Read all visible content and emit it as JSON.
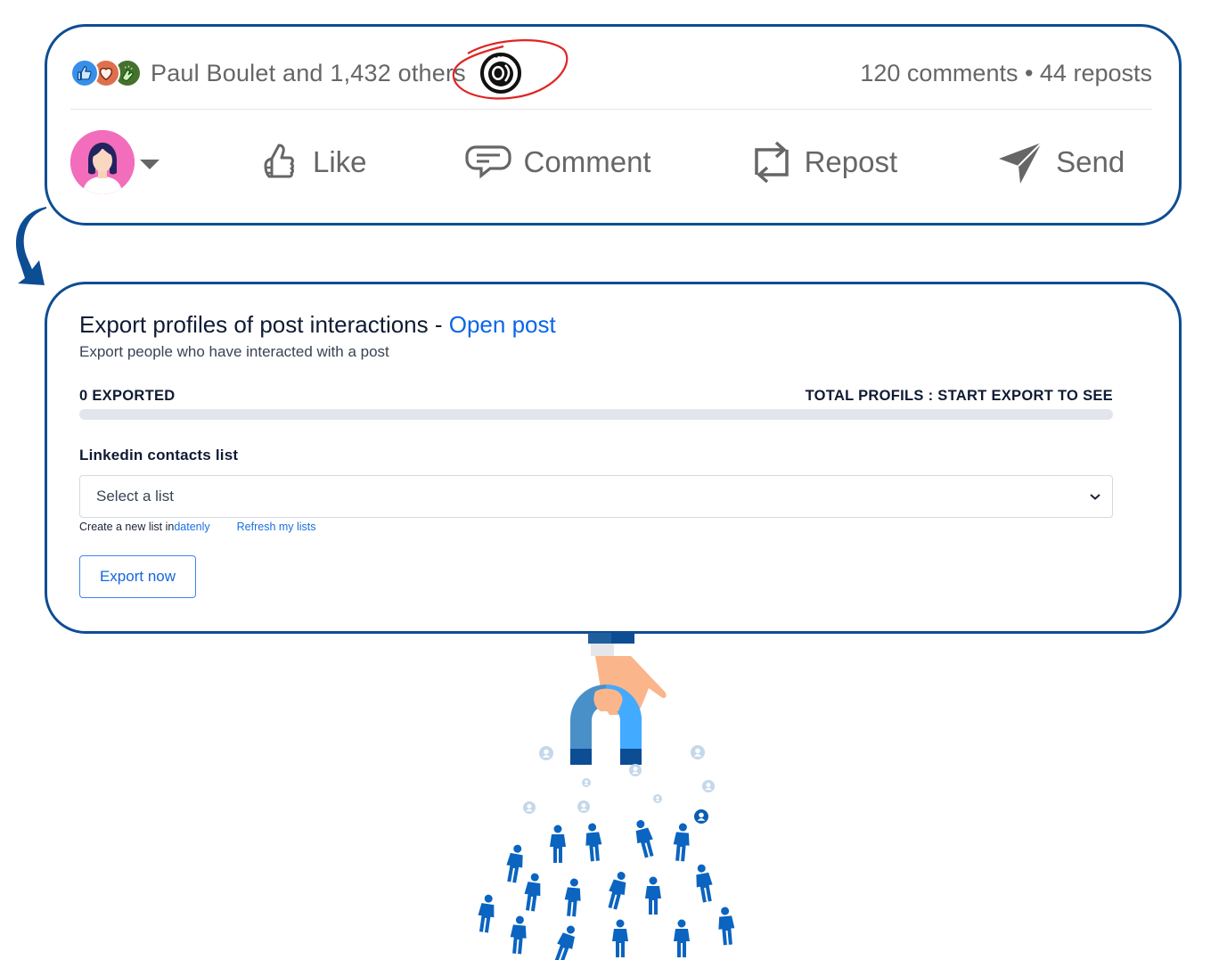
{
  "post": {
    "reactions": [
      {
        "icon": "like-reaction-icon",
        "color": "#378fe9"
      },
      {
        "icon": "love-reaction-icon",
        "color": "#df704d"
      },
      {
        "icon": "celebrate-reaction-icon",
        "color": "#44712e"
      }
    ],
    "reactors_text": "Paul Boulet and 1,432 others",
    "viewer_icon": "eye-icon",
    "stats_text": "120 comments • 44 reposts",
    "actions": [
      {
        "label": "Like",
        "icon": "thumbs-up-icon"
      },
      {
        "label": "Comment",
        "icon": "comment-icon"
      },
      {
        "label": "Repost",
        "icon": "repost-icon"
      },
      {
        "label": "Send",
        "icon": "send-icon"
      }
    ],
    "annotation_color": "#e02424"
  },
  "export": {
    "title": "Export profiles of post interactions - ",
    "title_link": "Open post",
    "subtitle": "Export people who have interacted with a post",
    "exported_label": "0 EXPORTED",
    "total_label": "TOTAL PROFILS : START EXPORT TO SEE",
    "progress_percent": 0,
    "list_label": "Linkedin contacts list",
    "select_value": "Select a list",
    "helper_text": "Create a new list in ",
    "helper_link": "datenly",
    "refresh_link": "Refresh my lists",
    "export_button": "Export now"
  },
  "colors": {
    "frame": "#0d4d94",
    "accent": "#0a66e8",
    "muted_text": "#666666"
  }
}
